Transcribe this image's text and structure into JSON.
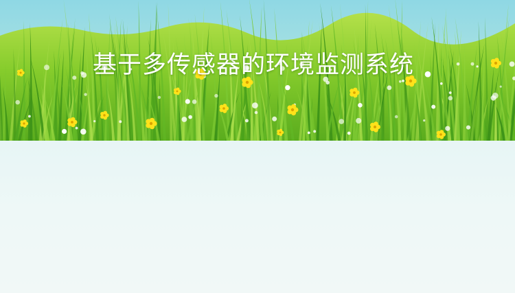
{
  "slide": {
    "title": "基于多传感器的环境监测系统"
  },
  "colors": {
    "sky": "#8fd8e4",
    "grass_light": "#a8dc3c",
    "grass_dark": "#4aa21c",
    "flower": "#ffe21a",
    "lower_background": "#eef7f6"
  },
  "decorations": {
    "banner_image": "meadow-grass-with-yellow-flowers"
  }
}
